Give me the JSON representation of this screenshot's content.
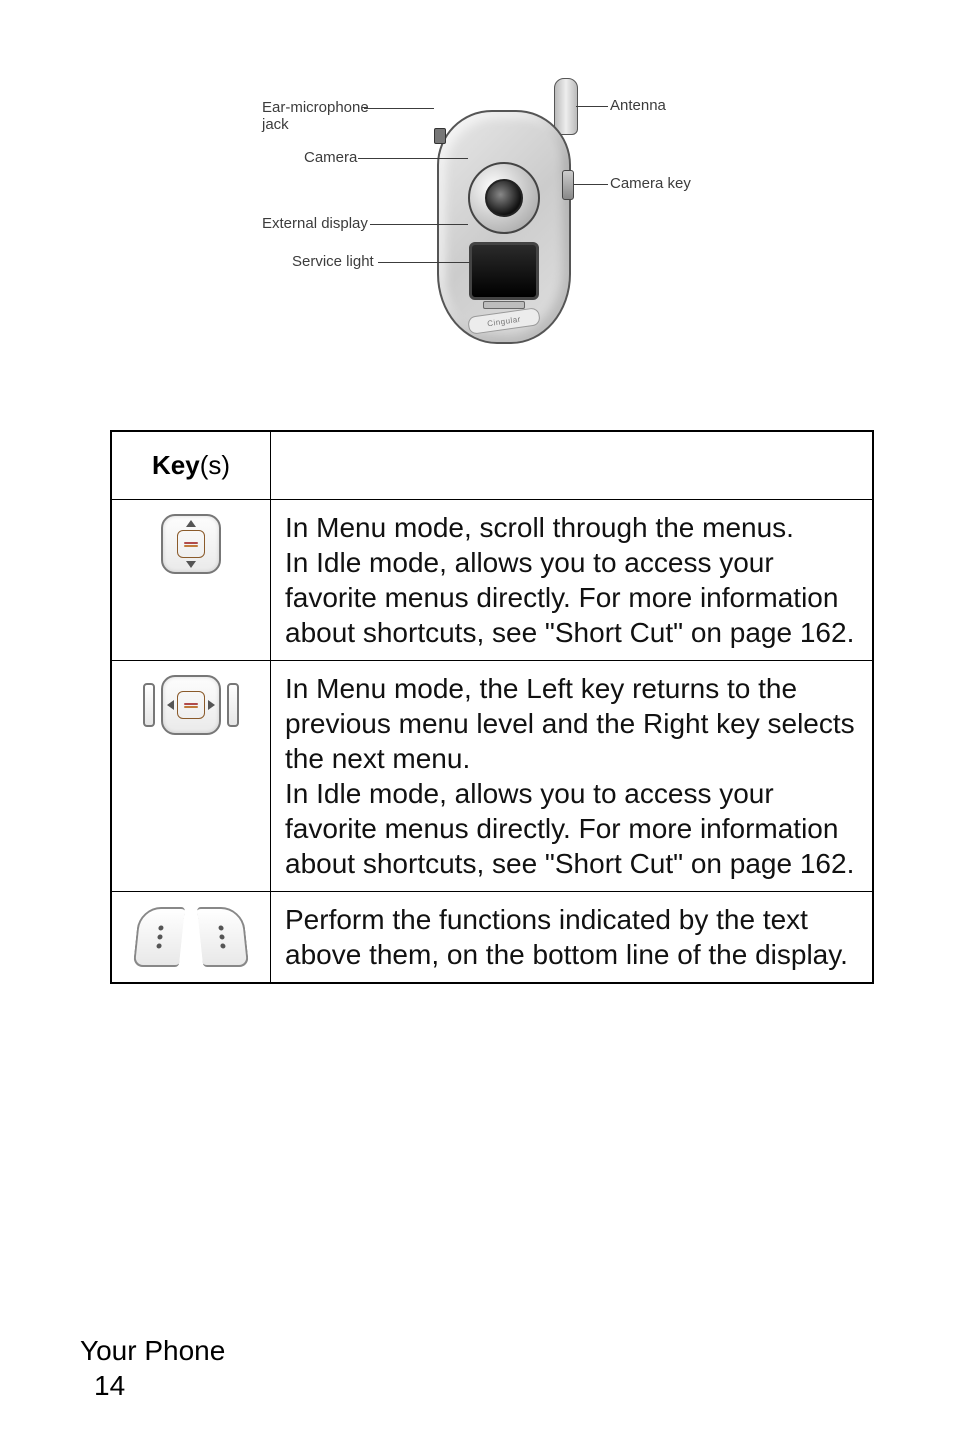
{
  "diagram": {
    "labels": {
      "ear_mic_jack": "Ear-microphone\njack",
      "camera": "Camera",
      "external_display": "External display",
      "service_light": "Service light",
      "antenna": "Antenna",
      "camera_key": "Camera key"
    },
    "brand_text": "Cingular"
  },
  "table": {
    "header_key": "Key",
    "header_key_suffix": "(s)",
    "rows": [
      {
        "icon": "nav-updown",
        "desc": "In Menu mode, scroll through the menus.\nIn Idle mode, allows you to access your favorite menus directly. For more information about shortcuts, see \"Short Cut\" on page 162."
      },
      {
        "icon": "nav-leftright",
        "desc": "In Menu mode, the Left key returns to the previous menu level and the Right key selects the next menu.\nIn Idle mode, allows you to access your favorite menus directly. For more information about shortcuts, see \"Short Cut\" on page 162."
      },
      {
        "icon": "softkeys",
        "desc": "Perform the functions indicated by the text above them, on the bottom line of the display."
      }
    ]
  },
  "footer": {
    "section": "Your Phone",
    "page": "14"
  }
}
